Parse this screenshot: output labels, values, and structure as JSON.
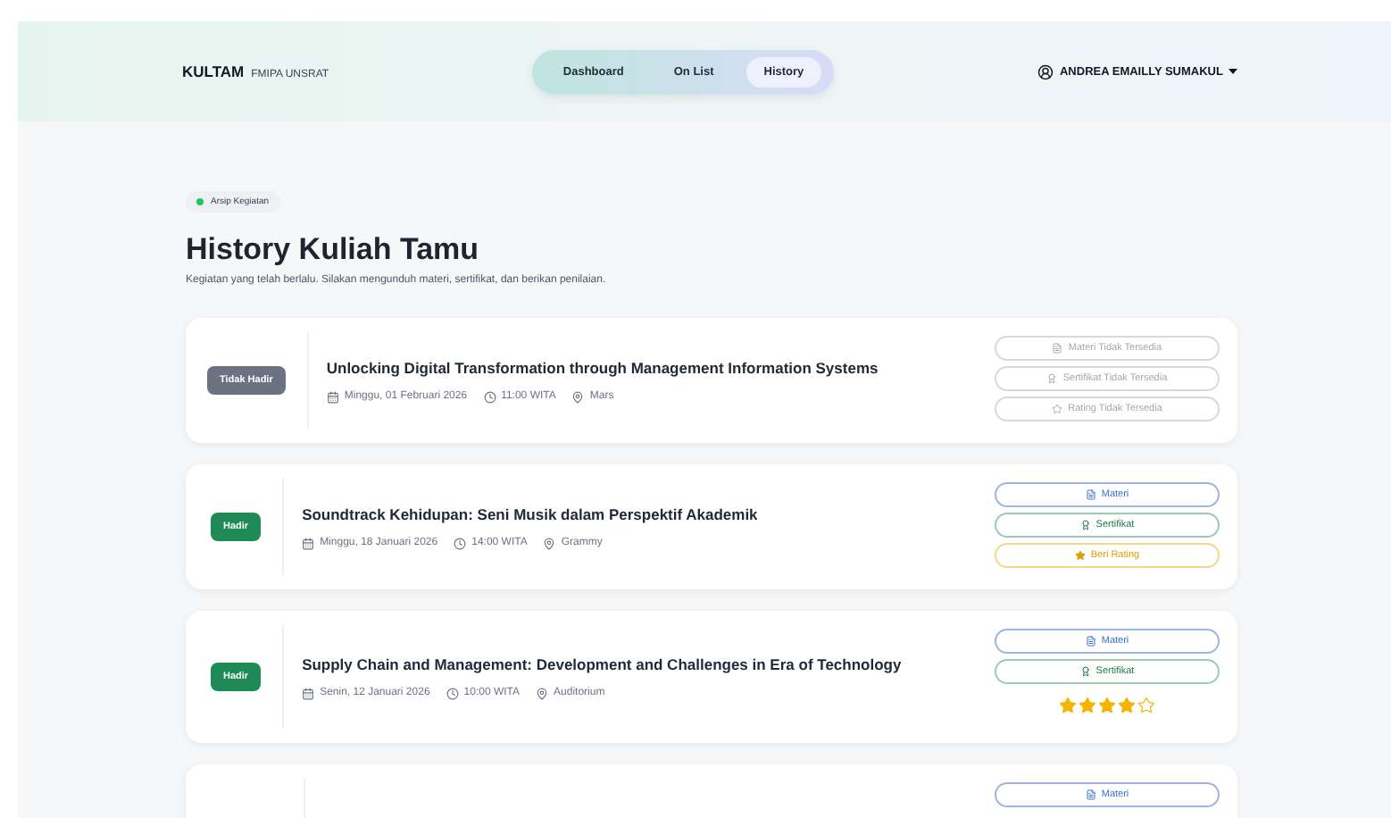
{
  "brand": {
    "name": "KULTAM",
    "sub": "FMIPA UNSRAT"
  },
  "nav": [
    {
      "label": "Dashboard",
      "selected": false
    },
    {
      "label": "On List",
      "selected": false
    },
    {
      "label": "History",
      "selected": true
    }
  ],
  "user": {
    "name": "ANDREA EMAILLY SUMAKUL"
  },
  "tag": "Arsip Kegiatan",
  "title": "History Kuliah Tamu",
  "subtitle": "Kegiatan yang telah berlalu. Silakan mengunduh materi, sertifikat, dan berikan penilaian.",
  "events": [
    {
      "status": {
        "label": "Tidak Hadir",
        "kind": "absent"
      },
      "title": "Unlocking Digital Transformation through Management Information Systems",
      "date": "Minggu, 01 Februari 2026",
      "time": "11:00 WITA",
      "place": "Mars",
      "actions": [
        {
          "kind": "materi",
          "label": "Materi Tidak Tersedia",
          "disabled": true
        },
        {
          "kind": "sertifikat",
          "label": "Sertifikat Tidak Tersedia",
          "disabled": true
        },
        {
          "kind": "rating",
          "label": "Rating Tidak Tersedia",
          "disabled": true
        }
      ]
    },
    {
      "status": {
        "label": "Hadir",
        "kind": "present"
      },
      "title": "Soundtrack Kehidupan: Seni Musik dalam Perspektif Akademik",
      "date": "Minggu, 18 Januari 2026",
      "time": "14:00 WITA",
      "place": "Grammy",
      "actions": [
        {
          "kind": "materi",
          "label": "Materi",
          "disabled": false
        },
        {
          "kind": "sertifikat",
          "label": "Sertifikat",
          "disabled": false
        },
        {
          "kind": "rating",
          "label": "Beri Rating",
          "disabled": false
        }
      ]
    },
    {
      "status": {
        "label": "Hadir",
        "kind": "present"
      },
      "title": "Supply Chain and Management: Development and Challenges in Era of Technology",
      "date": "Senin, 12 Januari 2026",
      "time": "10:00 WITA",
      "place": "Auditorium",
      "actions": [
        {
          "kind": "materi",
          "label": "Materi",
          "disabled": false
        },
        {
          "kind": "sertifikat",
          "label": "Sertifikat",
          "disabled": false
        },
        {
          "kind": "stars",
          "stars": 4
        }
      ]
    },
    {
      "actions": [
        {
          "kind": "materi",
          "label": "Materi",
          "disabled": false
        }
      ]
    }
  ]
}
